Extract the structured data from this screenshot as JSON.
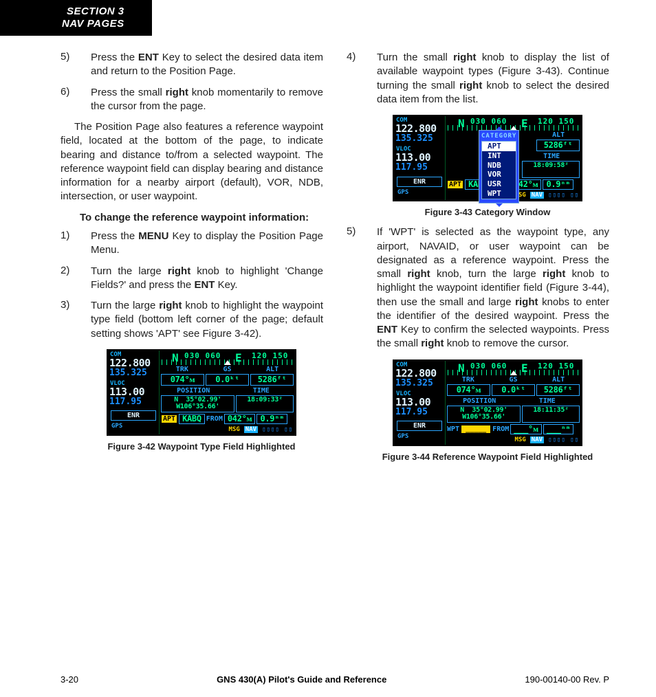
{
  "header": {
    "line1": "SECTION 3",
    "line2": "NAV PAGES"
  },
  "left": {
    "items56": [
      {
        "n": "5)",
        "html": "Press the <b>ENT</b> Key to select the desired data item and return to the Position Page."
      },
      {
        "n": "6)",
        "html": "Press the small <b>right</b> knob momentarily to remove the cursor from the page."
      }
    ],
    "para": "The Position Page also features a reference waypoint field, located at the bottom of the page, to indicate bearing and distance to/from a selected waypoint.  The reference waypoint field can display bearing and distance information for a nearby airport (default), VOR, NDB, intersection, or user waypoint.",
    "subhead": "To change the reference waypoint information:",
    "items123": [
      {
        "n": "1)",
        "html": "Press the <b>MENU</b> Key to display the Position Page Menu."
      },
      {
        "n": "2)",
        "html": "Turn the large <b>right</b> knob to highlight 'Change Fields?' and press the <b>ENT</b> Key."
      },
      {
        "n": "3)",
        "html": "Turn the large <b>right</b> knob to highlight the waypoint type field (bottom left corner of the page; default setting shows 'APT' see Figure 3-42)."
      }
    ],
    "caption42": "Figure 3-42  Waypoint Type Field Highlighted"
  },
  "right": {
    "item4": {
      "n": "4)",
      "html": "Turn the small <b>right</b> knob to display the list of available waypoint types (Figure 3-43). Continue turning the small <b>right</b> knob to select the desired data item from the list."
    },
    "caption43": "Figure 3-43  Category Window",
    "item5": {
      "n": "5)",
      "html": "If 'WPT' is selected as the waypoint type, any airport, NAVAID, or user waypoint can be designated as a reference waypoint.  Press the small <b>right</b> knob, turn the large <b>right</b> knob to highlight the waypoint identifier field (Figure 3-44), then use the small and large <b>right</b> knobs to enter the identifier of the desired waypoint.  Press the <b>ENT</b> Key to confirm the selected waypoints.  Press the small <b>right</b> knob to remove the cursor."
    },
    "caption44": "Figure 3-44  Reference Waypoint Field Highlighted"
  },
  "gps_common": {
    "com_label": "COM",
    "com_active": "122.800",
    "com_standby": "135.325",
    "vloc_label": "VLOC",
    "vloc_active": "113.00",
    "vloc_standby": "117.95",
    "enr": "ENR",
    "gps": "GPS",
    "compass_nums1": "030  060",
    "compass_nums2": "120  150",
    "labels_trk": "TRK",
    "labels_gs": "GS",
    "labels_alt": "ALT",
    "labels_pos": "POSITION",
    "labels_time": "TIME",
    "trk": "074°ᴍ",
    "gs": "0.0ᵏᵗ",
    "alt": "5286ᶠᵗ",
    "pos_line1": "N  35°02.99'",
    "pos_line2": "W106°35.66'",
    "foot_from": "FROM",
    "foot_brg": "042°ᴍ",
    "foot_dist": "0.9ⁿᵐ",
    "msg": "MSG",
    "nav": "NAV",
    "boxes": "▯▯▯▯ ▯▯"
  },
  "gps42": {
    "time": "18:09:33ᶻ",
    "foot_type": "APT",
    "foot_id": "KABQ"
  },
  "gps43": {
    "time": "18:09:58ᶻ",
    "cat_label": "CATEGORY",
    "options": [
      "APT",
      "INT",
      "NDB",
      "VOR",
      "USR",
      "WPT"
    ],
    "foot_type": "APT",
    "foot_id": "KABQ"
  },
  "gps44": {
    "time": "18:11:35ᶻ",
    "foot_type": "WPT",
    "foot_id": "_____",
    "foot_brg": "___°ᴍ",
    "foot_dist": "___ⁿᵐ"
  },
  "footer": {
    "left": "3-20",
    "mid": "GNS 430(A) Pilot's Guide and Reference",
    "right": "190-00140-00  Rev. P"
  }
}
